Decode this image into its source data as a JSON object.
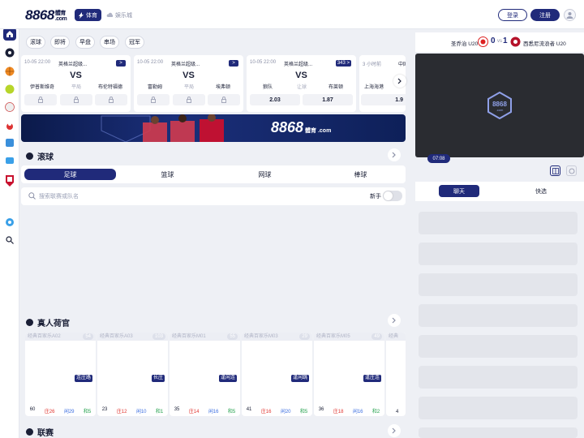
{
  "header": {
    "logo_main": "8868",
    "logo_sub_top": "體育",
    "logo_sub_bottom": ".com",
    "nav_sports": "体育",
    "nav_casino": "娱乐城",
    "login": "登录",
    "register": "注册"
  },
  "colors": {
    "brand": "#202a7a",
    "accent_red": "#e0342f",
    "background": "#eef0f5"
  },
  "filter_tabs": [
    "滚球",
    "即将",
    "早盘",
    "串场",
    "冠军"
  ],
  "matches": [
    {
      "time": "10-05 22:00",
      "league": "英格兰超级...",
      "badge": ">",
      "home": "伊普斯维奇",
      "draw": "平局",
      "away": "布伦特福德",
      "vs": "VS",
      "odd_home": "",
      "odd_draw": "",
      "odd_away": ""
    },
    {
      "time": "10-05 22:00",
      "league": "英格兰超级...",
      "badge": ">",
      "home": "富勒姆",
      "draw": "平局",
      "away": "埃弗顿",
      "vs": "VS",
      "odd_home": "",
      "odd_draw": "",
      "odd_away": ""
    },
    {
      "time": "10-05 22:00",
      "league": "英格兰超级...",
      "badge": "343 >",
      "home": "狼队",
      "draw": "让球",
      "away": "布莱顿",
      "vs": "VS",
      "odd_home": "2.03",
      "odd_draw": "",
      "odd_away": "1.87"
    },
    {
      "time": "3 小时前",
      "league": "中国",
      "badge": "",
      "home": "上海海港",
      "draw": "",
      "away": "",
      "vs": "",
      "odd_home": "1.9",
      "odd_draw": "",
      "odd_away": ""
    }
  ],
  "banner": {
    "brand": "8868",
    "brand_sub_top": "體育",
    "brand_sub_bottom": ".com"
  },
  "live_section": {
    "title": "滚球"
  },
  "sport_tabs": [
    "足球",
    "篮球",
    "网球",
    "棒球"
  ],
  "search": {
    "placeholder": "搜索联赛或队名",
    "toggle_label": "新手"
  },
  "dealer_section": {
    "title": "真人荷官"
  },
  "dealers": [
    {
      "title": "经典百家乐A02",
      "count": "54",
      "tag": "连庄路",
      "total": "60",
      "banker": "庄26",
      "player": "闲29",
      "tie": "和5"
    },
    {
      "title": "经典百家乐A03",
      "count": "103",
      "tag": "长庄",
      "total": "23",
      "banker": "庄12",
      "player": "闲10",
      "tie": "和1"
    },
    {
      "title": "经典百家乐M01",
      "count": "55",
      "tag": "逢闲连",
      "total": "35",
      "banker": "庄14",
      "player": "闲16",
      "tie": "和5"
    },
    {
      "title": "经典百家乐M03",
      "count": "29",
      "tag": "逢闲跳",
      "total": "41",
      "banker": "庄16",
      "player": "闲20",
      "tie": "和5"
    },
    {
      "title": "经典百家乐M05",
      "count": "49",
      "tag": "逢庄连",
      "total": "36",
      "banker": "庄18",
      "player": "闲16",
      "tie": "和2"
    },
    {
      "title": "经典",
      "count": "",
      "tag": "",
      "total": "4",
      "banker": "",
      "player": "",
      "tie": ""
    }
  ],
  "league_section": {
    "title": "联赛"
  },
  "right_panel": {
    "home_team": "圣乔治 U20",
    "home_score": "0",
    "vs": "vs",
    "away_score": "1",
    "away_team": "西悉尼流浪者 U20",
    "video_time": "07:08",
    "tab_chat": "聊天",
    "tab_bet": "快选"
  }
}
